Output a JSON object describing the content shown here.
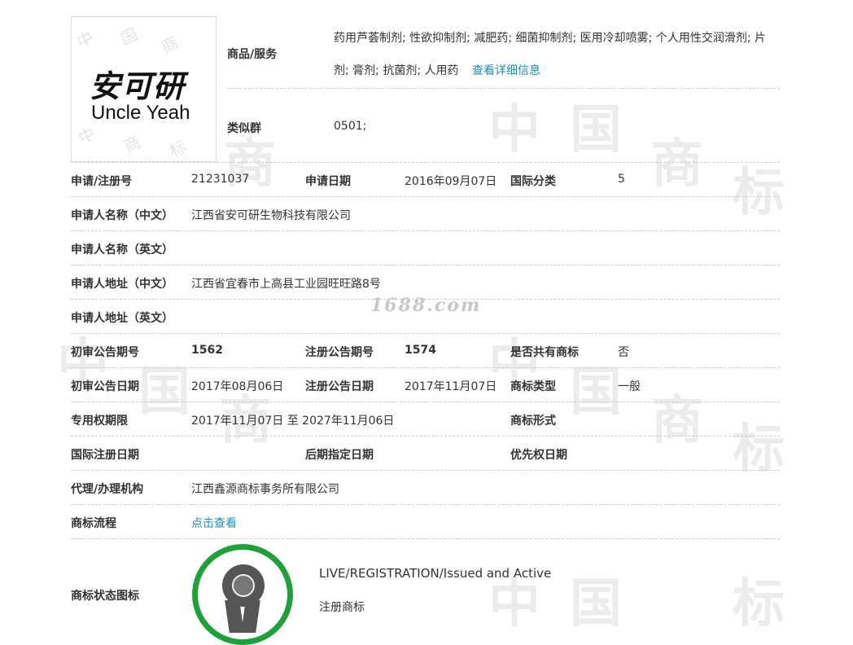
{
  "watermark": {
    "site": "1688.com",
    "chars": [
      "中",
      "国",
      "商",
      "标"
    ]
  },
  "logo": {
    "cn": "安可研",
    "en": "Uncle Yeah",
    "wm_chars": [
      "中",
      "国",
      "商",
      "标"
    ]
  },
  "goods": {
    "label": "商品/服务",
    "line1": "药用芦荟制剂; 性欲抑制剂; 减肥药; 细菌抑制剂; 医用冷却喷雾; 个人用性交润滑剂; 片",
    "line2": "剂; 膏剂; 抗菌剂; 人用药",
    "detail_link": "查看详细信息"
  },
  "similar": {
    "label": "类似群",
    "value": "0501;"
  },
  "fields": {
    "reg_no_label": "申请/注册号",
    "reg_no": "21231037",
    "apply_date_label": "申请日期",
    "apply_date": "2016年09月07日",
    "intl_class_label": "国际分类",
    "intl_class": "5",
    "applicant_cn_label": "申请人名称（中文）",
    "applicant_cn": "江西省安可研生物科技有限公司",
    "applicant_en_label": "申请人名称（英文）",
    "address_cn_label": "申请人地址（中文）",
    "address_cn": "江西省宜春市上高县工业园旺旺路8号",
    "address_en_label": "申请人地址（英文）",
    "prelim_issue_label": "初审公告期号",
    "prelim_issue": "1562",
    "reg_issue_label": "注册公告期号",
    "reg_issue": "1574",
    "shared_label": "是否共有商标",
    "shared": "否",
    "prelim_date_label": "初审公告日期",
    "prelim_date": "2017年08月06日",
    "reg_date_label": "注册公告日期",
    "reg_date": "2017年11月07日",
    "tm_type_label": "商标类型",
    "tm_type": "一般",
    "exclusive_label": "专用权期限",
    "exclusive": "2017年11月07日 至 2027年11月06日",
    "tm_form_label": "商标形式",
    "intl_reg_date_label": "国际注册日期",
    "later_date_label": "后期指定日期",
    "priority_date_label": "优先权日期",
    "agent_label": "代理/办理机构",
    "agent": "江西鑫源商标事务所有限公司",
    "process_label": "商标流程",
    "process_link": "点击查看",
    "status_icon_label": "商标状态图标"
  },
  "status": {
    "en": "LIVE/REGISTRATION/Issued and Active",
    "cn": "注册商标",
    "ring_color": "#20a03a"
  }
}
